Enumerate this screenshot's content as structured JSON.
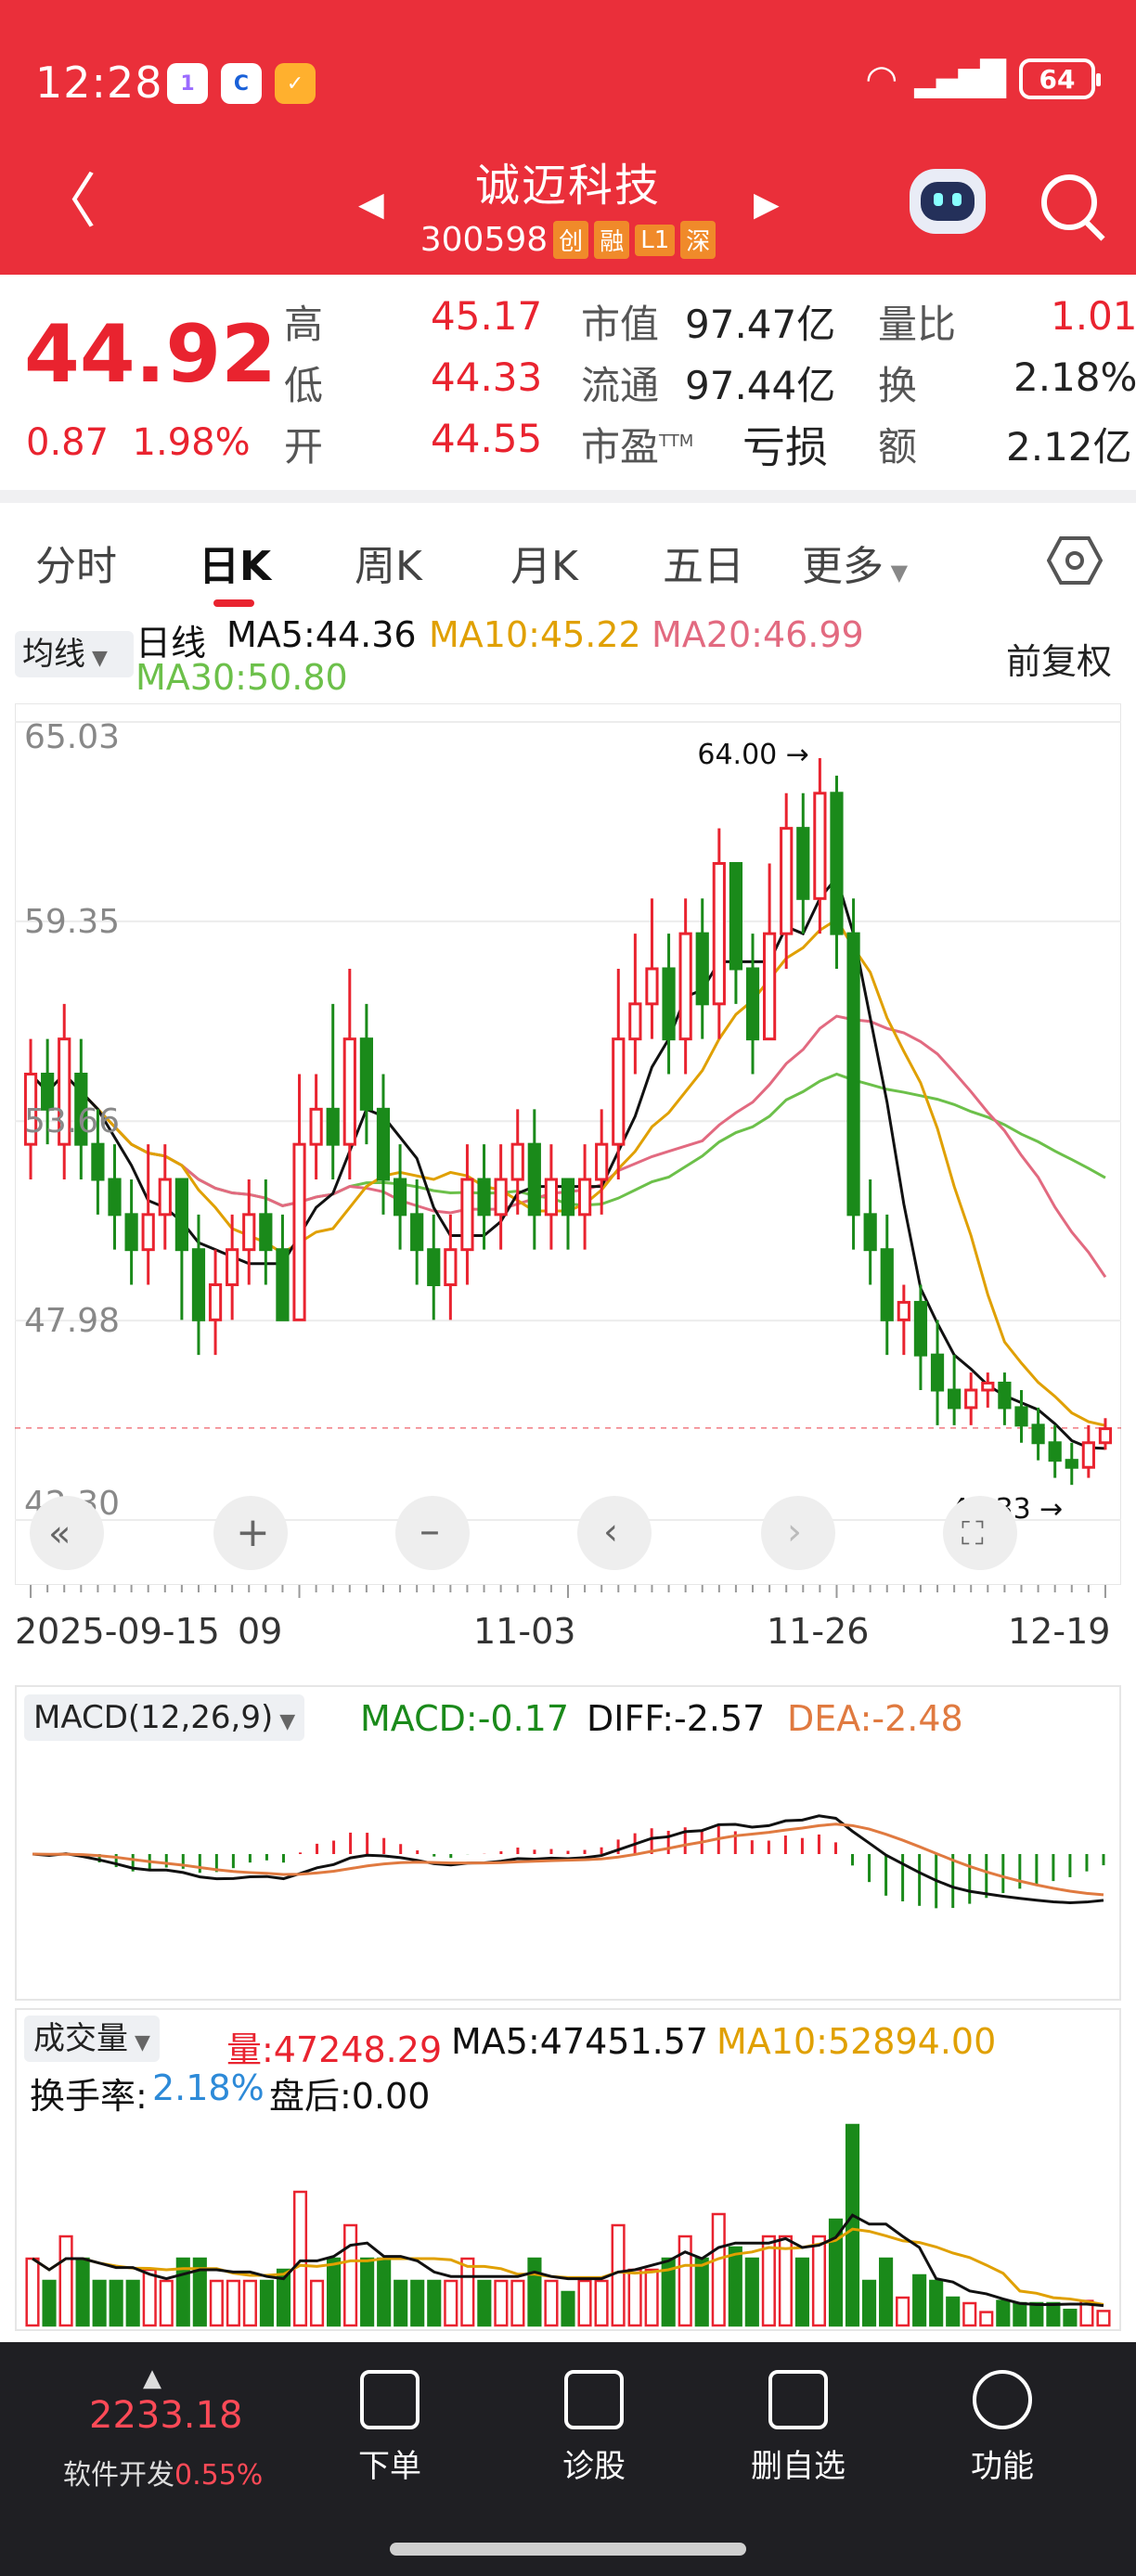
{
  "status": {
    "time": "12:28",
    "battery": "64"
  },
  "header": {
    "name": "诚迈科技",
    "code": "300598",
    "tags": [
      "创",
      "融",
      "L1",
      "深"
    ]
  },
  "quote": {
    "price": "44.92",
    "change": "0.87",
    "change_pct": "1.98%",
    "high_label": "高",
    "high": "45.17",
    "low_label": "低",
    "low": "44.33",
    "open_label": "开",
    "open": "44.55",
    "mktcap_label": "市值",
    "mktcap": "97.47亿",
    "float_label": "流通",
    "float": "97.44亿",
    "pe_label": "市盈",
    "pe_sup": "TTM",
    "pe": "亏损",
    "vr_label": "量比",
    "vr": "1.01",
    "turn_label": "换",
    "turn": "2.18%",
    "amt_label": "额",
    "amt": "2.12亿"
  },
  "tabs": [
    "分时",
    "日K",
    "周K",
    "月K",
    "五日",
    "更多"
  ],
  "ma": {
    "select": "均线",
    "period": "日线",
    "ma5": "MA5:44.36",
    "ma10": "MA10:45.22",
    "ma20": "MA20:46.99",
    "ma30": "MA30:50.80",
    "adjust": "前复权"
  },
  "colors": {
    "up": "#e9232f",
    "down": "#1a8a1a",
    "ma5": "#111111",
    "ma10": "#e0a000",
    "ma20": "#e26a80",
    "ma30": "#6cc04a"
  },
  "chart_data": {
    "type": "candlestick",
    "y_ticks": [
      "65.03",
      "59.35",
      "53.66",
      "47.98",
      "42.30"
    ],
    "ylim": [
      42.3,
      65.03
    ],
    "x_ticks": [
      "2025-09-15",
      "09",
      "11-03",
      "11-26",
      "12-19"
    ],
    "max_label": "64.00",
    "min_label": "43.33",
    "candles": [
      [
        53,
        55,
        56,
        52
      ],
      [
        55,
        54,
        56,
        53
      ],
      [
        53,
        56,
        57,
        52
      ],
      [
        55,
        53,
        56,
        52
      ],
      [
        53,
        52,
        54,
        51
      ],
      [
        52,
        51,
        53,
        50
      ],
      [
        51,
        50,
        52,
        49
      ],
      [
        50,
        51,
        53,
        49
      ],
      [
        51,
        52,
        53,
        50
      ],
      [
        52,
        50,
        52,
        48
      ],
      [
        50,
        48,
        51,
        47
      ],
      [
        48,
        49,
        50,
        47
      ],
      [
        49,
        50,
        51,
        48
      ],
      [
        50,
        51,
        52,
        49
      ],
      [
        51,
        50,
        52,
        49
      ],
      [
        50,
        48,
        51,
        48
      ],
      [
        48,
        53,
        55,
        48
      ],
      [
        53,
        54,
        55,
        52
      ],
      [
        54,
        53,
        57,
        52
      ],
      [
        53,
        56,
        58,
        52
      ],
      [
        56,
        54,
        57,
        53
      ],
      [
        54,
        52,
        55,
        51
      ],
      [
        52,
        51,
        53,
        50
      ],
      [
        51,
        50,
        52,
        49
      ],
      [
        50,
        49,
        51,
        48
      ],
      [
        49,
        50,
        51,
        48
      ],
      [
        50,
        52,
        53,
        49
      ],
      [
        52,
        51,
        53,
        50
      ],
      [
        51,
        52,
        53,
        50
      ],
      [
        52,
        53,
        54,
        51
      ],
      [
        53,
        51,
        54,
        50
      ],
      [
        51,
        52,
        53,
        50
      ],
      [
        52,
        51,
        52,
        50
      ],
      [
        51,
        52,
        53,
        50
      ],
      [
        52,
        53,
        54,
        51
      ],
      [
        53,
        56,
        58,
        52
      ],
      [
        56,
        57,
        59,
        55
      ],
      [
        57,
        58,
        60,
        56
      ],
      [
        58,
        56,
        59,
        55
      ],
      [
        56,
        59,
        60,
        55
      ],
      [
        59,
        57,
        60,
        56
      ],
      [
        57,
        61,
        62,
        56
      ],
      [
        61,
        58,
        61,
        57
      ],
      [
        58,
        56,
        59,
        55
      ],
      [
        56,
        59,
        61,
        56
      ],
      [
        59,
        62,
        63,
        58
      ],
      [
        62,
        60,
        63,
        59
      ],
      [
        60,
        63,
        64,
        59
      ],
      [
        63,
        59,
        63.5,
        58
      ],
      [
        59,
        51,
        60,
        50
      ],
      [
        51,
        50,
        52,
        49
      ],
      [
        50,
        48,
        51,
        47
      ],
      [
        48,
        48.5,
        49,
        47
      ],
      [
        48.5,
        47,
        49,
        46
      ],
      [
        47,
        46,
        48,
        45
      ],
      [
        46,
        45.5,
        47,
        45
      ],
      [
        45.5,
        46,
        46.5,
        45
      ],
      [
        46,
        46.2,
        46.5,
        45.5
      ],
      [
        46.2,
        45.5,
        46.5,
        45
      ],
      [
        45.5,
        45,
        46,
        44.5
      ],
      [
        45,
        44.5,
        45.5,
        44
      ],
      [
        44.5,
        44,
        45,
        43.5
      ],
      [
        44,
        43.8,
        44.5,
        43.3
      ],
      [
        43.8,
        44.5,
        45,
        43.5
      ],
      [
        44.5,
        44.9,
        45.2,
        44.3
      ]
    ],
    "macd": {
      "label": "MACD(12,26,9)",
      "macd": "MACD:-0.17",
      "diff": "DIFF:-2.57",
      "dea": "DEA:-2.48"
    },
    "volume": {
      "label": "成交量",
      "vol": "量:47248.29",
      "ma5": "MA5:47451.57",
      "ma10": "MA10:52894.00",
      "turn_label": "换手率:",
      "turn": "2.18%",
      "after": "盘后:0.00"
    }
  },
  "bottom": {
    "index_value": "2233.18",
    "index_name": "软件开发",
    "index_change": "0.55%",
    "items": [
      "下单",
      "诊股",
      "删自选",
      "功能"
    ]
  }
}
